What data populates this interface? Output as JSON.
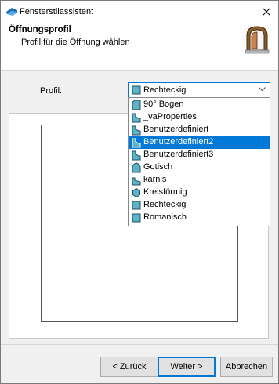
{
  "window": {
    "title": "Fensterstilassistent"
  },
  "header": {
    "title": "Öffnungsprofil",
    "subtitle": "Profil für die Öffnung wählen"
  },
  "form": {
    "profile_label": "Profil:",
    "profile_value": "Rechteckig"
  },
  "dropdown": {
    "items": [
      {
        "label": "90° Bogen",
        "icon": "arch-icon"
      },
      {
        "label": "_vaProperties",
        "icon": "custom-profile-icon"
      },
      {
        "label": "Benutzerdefiniert",
        "icon": "custom-profile-icon"
      },
      {
        "label": "Benutzerdefiniert2",
        "icon": "custom-profile-icon"
      },
      {
        "label": "Benutzerdefiniert3",
        "icon": "custom-profile-icon"
      },
      {
        "label": "Gotisch",
        "icon": "gothic-arch-icon"
      },
      {
        "label": "karnis",
        "icon": "custom-profile-icon"
      },
      {
        "label": "Kreisförmig",
        "icon": "circle-icon"
      },
      {
        "label": "Rechteckig",
        "icon": "rectangle-icon"
      },
      {
        "label": "Romanisch",
        "icon": "rectangle-icon"
      }
    ],
    "selected_index": 3
  },
  "buttons": {
    "back": "< Zurück",
    "next": "Weiter >",
    "cancel": "Abbrechen"
  },
  "colors": {
    "accent": "#0078d7",
    "icon_fill": "#5fb3c9",
    "icon_stroke": "#1e4f5e"
  }
}
